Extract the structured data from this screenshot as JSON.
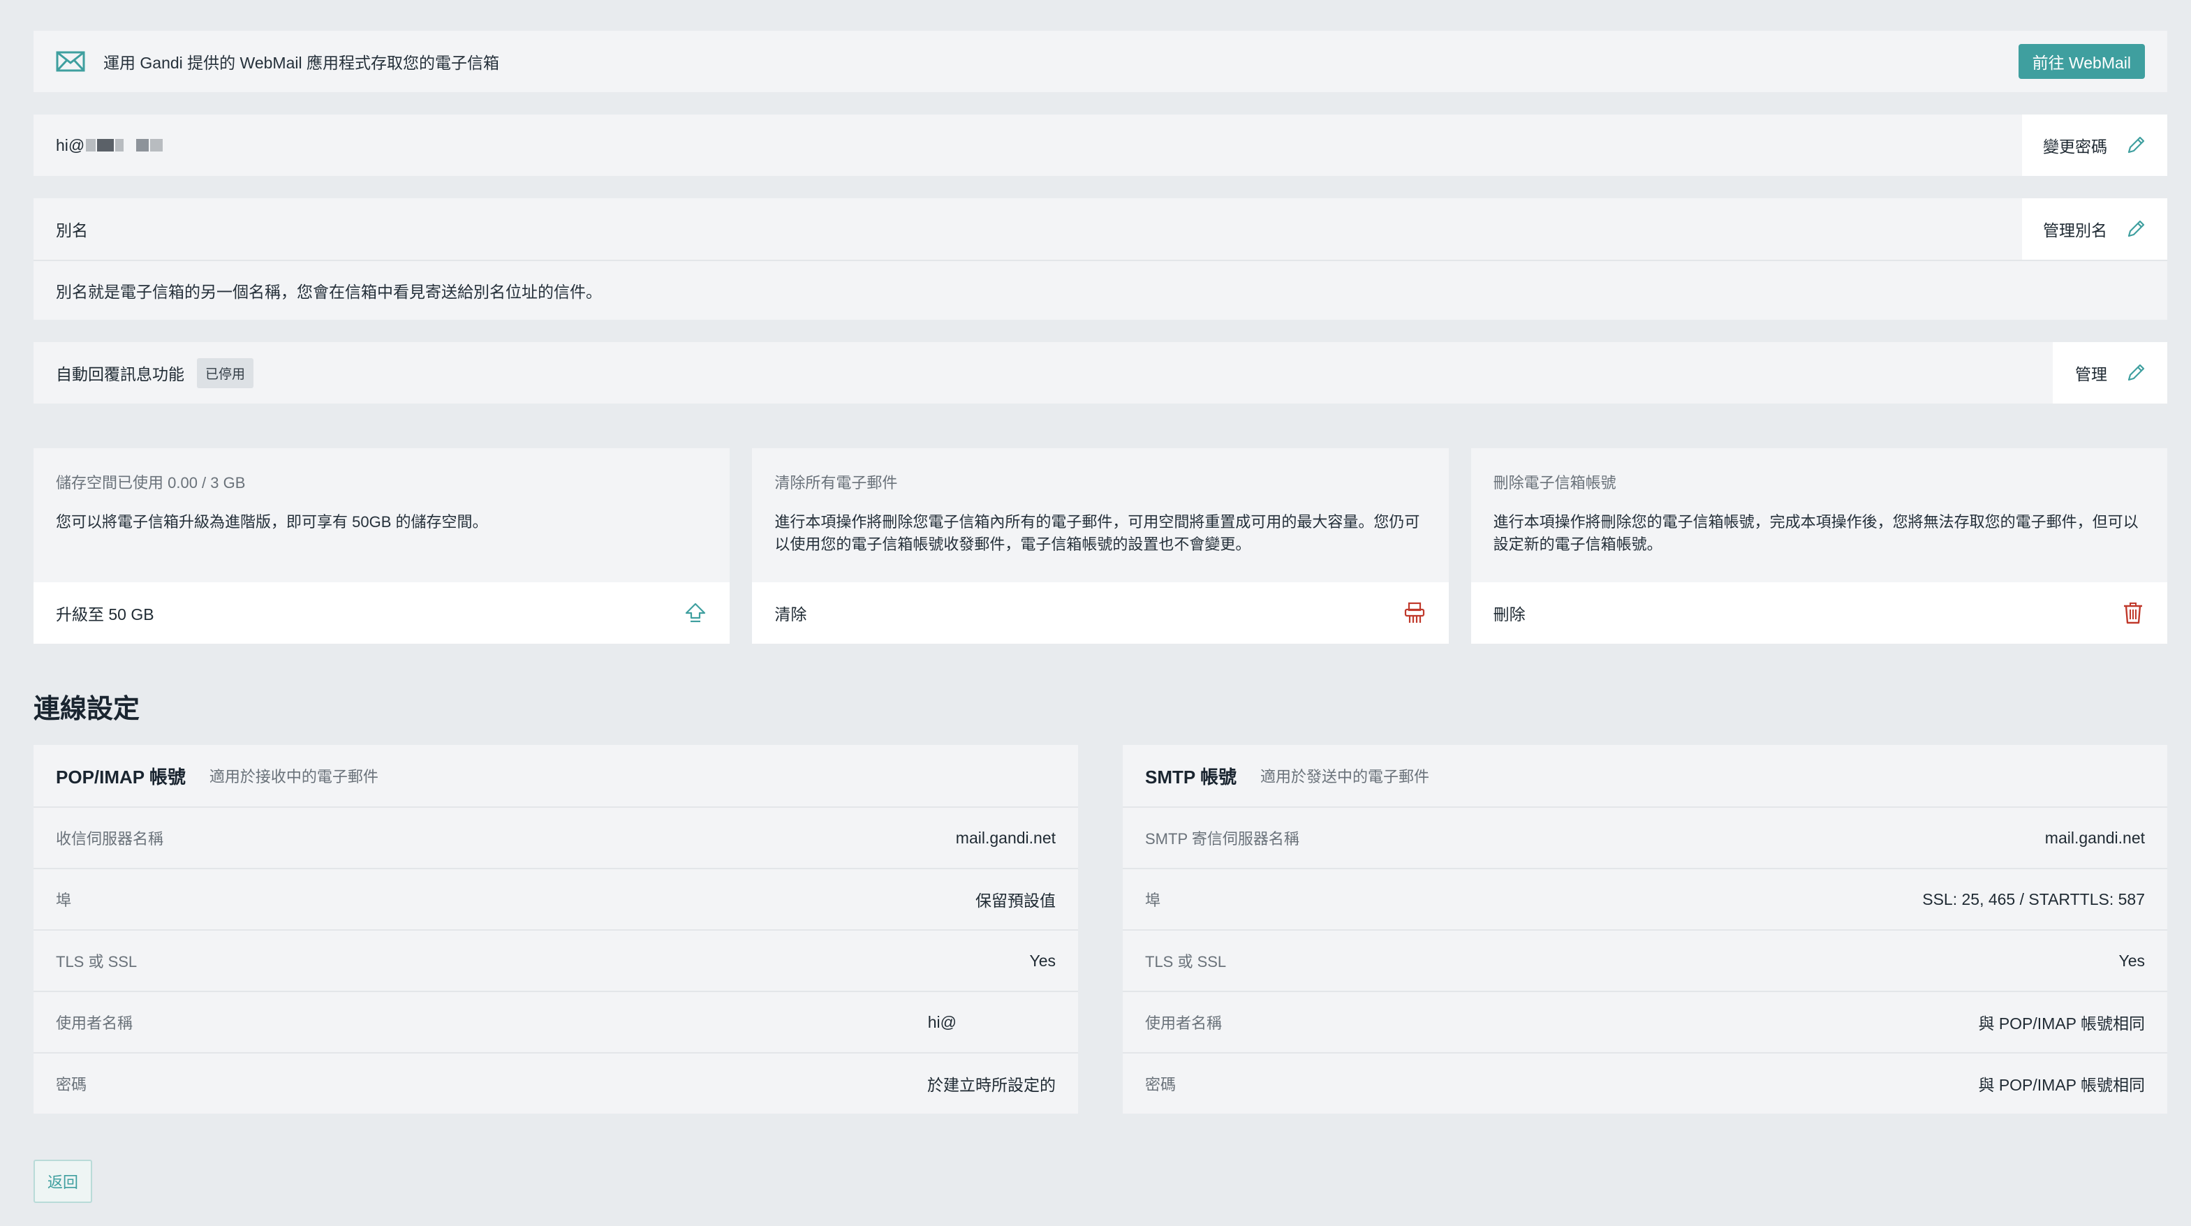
{
  "banner": {
    "text": "運用 Gandi 提供的 WebMail 應用程式存取您的電子信箱",
    "button": "前往 WebMail",
    "icon": "mail-icon"
  },
  "account": {
    "email": "hi@",
    "change_password": "變更密碼"
  },
  "alias": {
    "title": "別名",
    "manage": "管理別名",
    "description": "別名就是電子信箱的另一個名稱，您會在信箱中看見寄送給別名位址的信件。"
  },
  "autoreply": {
    "title": "自動回覆訊息功能",
    "status": "已停用",
    "manage": "管理"
  },
  "cards": [
    {
      "title": "儲存空間已使用 0.00 / 3 GB",
      "description": "您可以將電子信箱升級為進階版，即可享有 50GB 的儲存空間。",
      "action": "升級至 50 GB",
      "icon": "upgrade-arrow-icon"
    },
    {
      "title": "清除所有電子郵件",
      "description": "進行本項操作將刪除您電子信箱內所有的電子郵件，可用空間將重置成可用的最大容量。您仍可以使用您的電子信箱帳號收發郵件，電子信箱帳號的設置也不會變更。",
      "action": "清除",
      "icon": "shredder-icon"
    },
    {
      "title": "刪除電子信箱帳號",
      "description": "進行本項操作將刪除您的電子信箱帳號，完成本項操作後，您將無法存取您的電子郵件，但可以設定新的電子信箱帳號。",
      "action": "刪除",
      "icon": "trash-icon"
    }
  ],
  "connection": {
    "title": "連線設定",
    "pop": {
      "title": "POP/IMAP 帳號",
      "subtitle": "適用於接收中的電子郵件",
      "rows": [
        {
          "key": "收信伺服器名稱",
          "value": "mail.gandi.net"
        },
        {
          "key": "埠",
          "value": "保留預設值"
        },
        {
          "key": "TLS 或 SSL",
          "value": "Yes"
        },
        {
          "key": "使用者名稱",
          "value": "hi@"
        },
        {
          "key": "密碼",
          "value": "於建立時所設定的"
        }
      ]
    },
    "smtp": {
      "title": "SMTP 帳號",
      "subtitle": "適用於發送中的電子郵件",
      "rows": [
        {
          "key": "SMTP 寄信伺服器名稱",
          "value": "mail.gandi.net"
        },
        {
          "key": "埠",
          "value": "SSL: 25, 465 / STARTTLS: 587"
        },
        {
          "key": "TLS 或 SSL",
          "value": "Yes"
        },
        {
          "key": "使用者名稱",
          "value": "與 POP/IMAP 帳號相同"
        },
        {
          "key": "密碼",
          "value": "與 POP/IMAP 帳號相同"
        }
      ]
    }
  },
  "back_button": "返回",
  "colors": {
    "accent": "#3f9f9f",
    "danger": "#c0392b",
    "background": "#e8ebee",
    "panel": "#f3f4f6"
  }
}
